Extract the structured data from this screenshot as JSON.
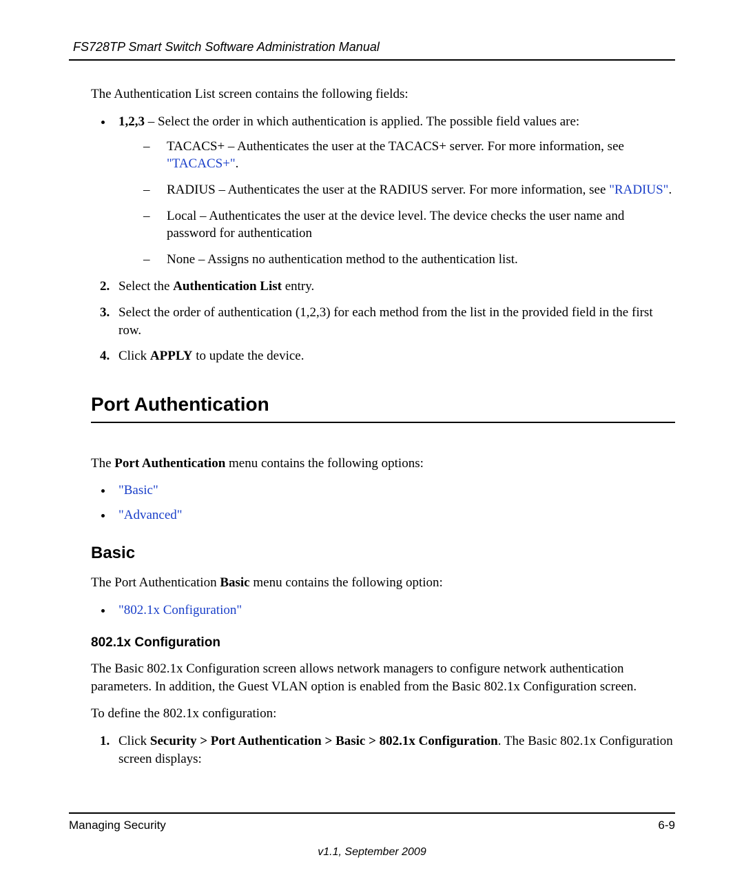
{
  "header": {
    "running": "FS728TP Smart Switch Software Administration Manual"
  },
  "intro": "The Authentication List screen contains the following fields:",
  "bullet1": {
    "lead_bold": "1,2,3",
    "lead_rest": " – Select the order in which authentication is applied. The possible field values are:",
    "sub": {
      "tacacs_pre": "TACACS+ – Authenticates the user at the TACACS+ server. For more information, see ",
      "tacacs_link": "\"TACACS+\"",
      "tacacs_post": ".",
      "radius_pre": "RADIUS – Authenticates the user at the RADIUS server. For more information, see ",
      "radius_link": "\"RADIUS\"",
      "radius_post": ".",
      "local": "Local – Authenticates the user at the device level. The device checks the user name and password for authentication",
      "none": "None – Assigns no authentication method to the authentication list."
    }
  },
  "step2_pre": "Select the ",
  "step2_bold": "Authentication List",
  "step2_post": " entry.",
  "step3": "Select the order of authentication (1,2,3) for each method from the list in the provided field in the first row.",
  "step4_pre": "Click ",
  "step4_bold": "APPLY",
  "step4_post": " to update the device.",
  "section": {
    "title": "Port Authentication",
    "intro_pre": "The ",
    "intro_bold": "Port Authentication",
    "intro_post": " menu contains the following options:",
    "links": {
      "basic": "\"Basic\"",
      "advanced": "\"Advanced\""
    }
  },
  "basic": {
    "title": "Basic",
    "intro_pre": "The Port Authentication ",
    "intro_bold": "Basic",
    "intro_post": " menu contains the following option:",
    "link": "\"802.1x Configuration\""
  },
  "config": {
    "title": "802.1x Configuration",
    "para": "The Basic 802.1x Configuration screen allows network managers to configure network authentication parameters. In addition, the Guest VLAN option is enabled from the Basic 802.1x Configuration screen.",
    "lead": "To define the 802.1x configuration:",
    "step1_pre": "Click ",
    "step1_bold": "Security > Port Authentication > Basic > 802.1x Configuration",
    "step1_post": ". The Basic 802.1x Configuration screen displays:"
  },
  "footer": {
    "left": "Managing Security",
    "right": "6-9",
    "center": "v1.1, September 2009"
  }
}
